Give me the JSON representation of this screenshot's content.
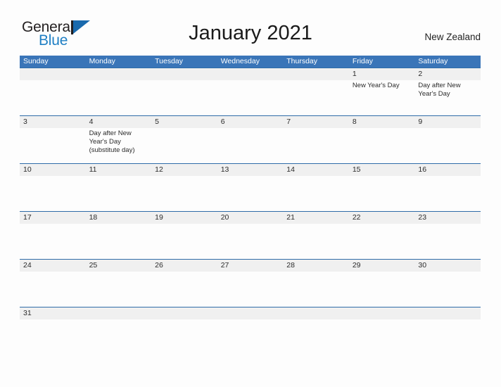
{
  "brand": {
    "name_part1": "General",
    "name_part2": "Blue",
    "colors": {
      "dark": "#231f20",
      "blue": "#1f7fc4",
      "flag": "#1a6aad"
    }
  },
  "header": {
    "title": "January 2021",
    "country": "New Zealand"
  },
  "theme": {
    "header_blue": "#3a75b8",
    "row_divider_blue": "#2f6ca8",
    "number_band_gray": "#f0f0f0",
    "page_background": "#fdfdfd",
    "text_dark": "#2b2b2b"
  },
  "calendar": {
    "month": "January",
    "year": "2021",
    "weekday_headers": [
      "Sunday",
      "Monday",
      "Tuesday",
      "Wednesday",
      "Thursday",
      "Friday",
      "Saturday"
    ],
    "weeks": [
      {
        "days": [
          {
            "number": "",
            "events": []
          },
          {
            "number": "",
            "events": []
          },
          {
            "number": "",
            "events": []
          },
          {
            "number": "",
            "events": []
          },
          {
            "number": "",
            "events": []
          },
          {
            "number": "1",
            "events": [
              "New Year's Day"
            ]
          },
          {
            "number": "2",
            "events": [
              "Day after New Year's Day"
            ]
          }
        ]
      },
      {
        "days": [
          {
            "number": "3",
            "events": []
          },
          {
            "number": "4",
            "events": [
              "Day after New Year's Day (substitute day)"
            ]
          },
          {
            "number": "5",
            "events": []
          },
          {
            "number": "6",
            "events": []
          },
          {
            "number": "7",
            "events": []
          },
          {
            "number": "8",
            "events": []
          },
          {
            "number": "9",
            "events": []
          }
        ]
      },
      {
        "days": [
          {
            "number": "10",
            "events": []
          },
          {
            "number": "11",
            "events": []
          },
          {
            "number": "12",
            "events": []
          },
          {
            "number": "13",
            "events": []
          },
          {
            "number": "14",
            "events": []
          },
          {
            "number": "15",
            "events": []
          },
          {
            "number": "16",
            "events": []
          }
        ]
      },
      {
        "days": [
          {
            "number": "17",
            "events": []
          },
          {
            "number": "18",
            "events": []
          },
          {
            "number": "19",
            "events": []
          },
          {
            "number": "20",
            "events": []
          },
          {
            "number": "21",
            "events": []
          },
          {
            "number": "22",
            "events": []
          },
          {
            "number": "23",
            "events": []
          }
        ]
      },
      {
        "days": [
          {
            "number": "24",
            "events": []
          },
          {
            "number": "25",
            "events": []
          },
          {
            "number": "26",
            "events": []
          },
          {
            "number": "27",
            "events": []
          },
          {
            "number": "28",
            "events": []
          },
          {
            "number": "29",
            "events": []
          },
          {
            "number": "30",
            "events": []
          }
        ]
      },
      {
        "days": [
          {
            "number": "31",
            "events": []
          },
          {
            "number": "",
            "events": []
          },
          {
            "number": "",
            "events": []
          },
          {
            "number": "",
            "events": []
          },
          {
            "number": "",
            "events": []
          },
          {
            "number": "",
            "events": []
          },
          {
            "number": "",
            "events": []
          }
        ]
      }
    ]
  }
}
